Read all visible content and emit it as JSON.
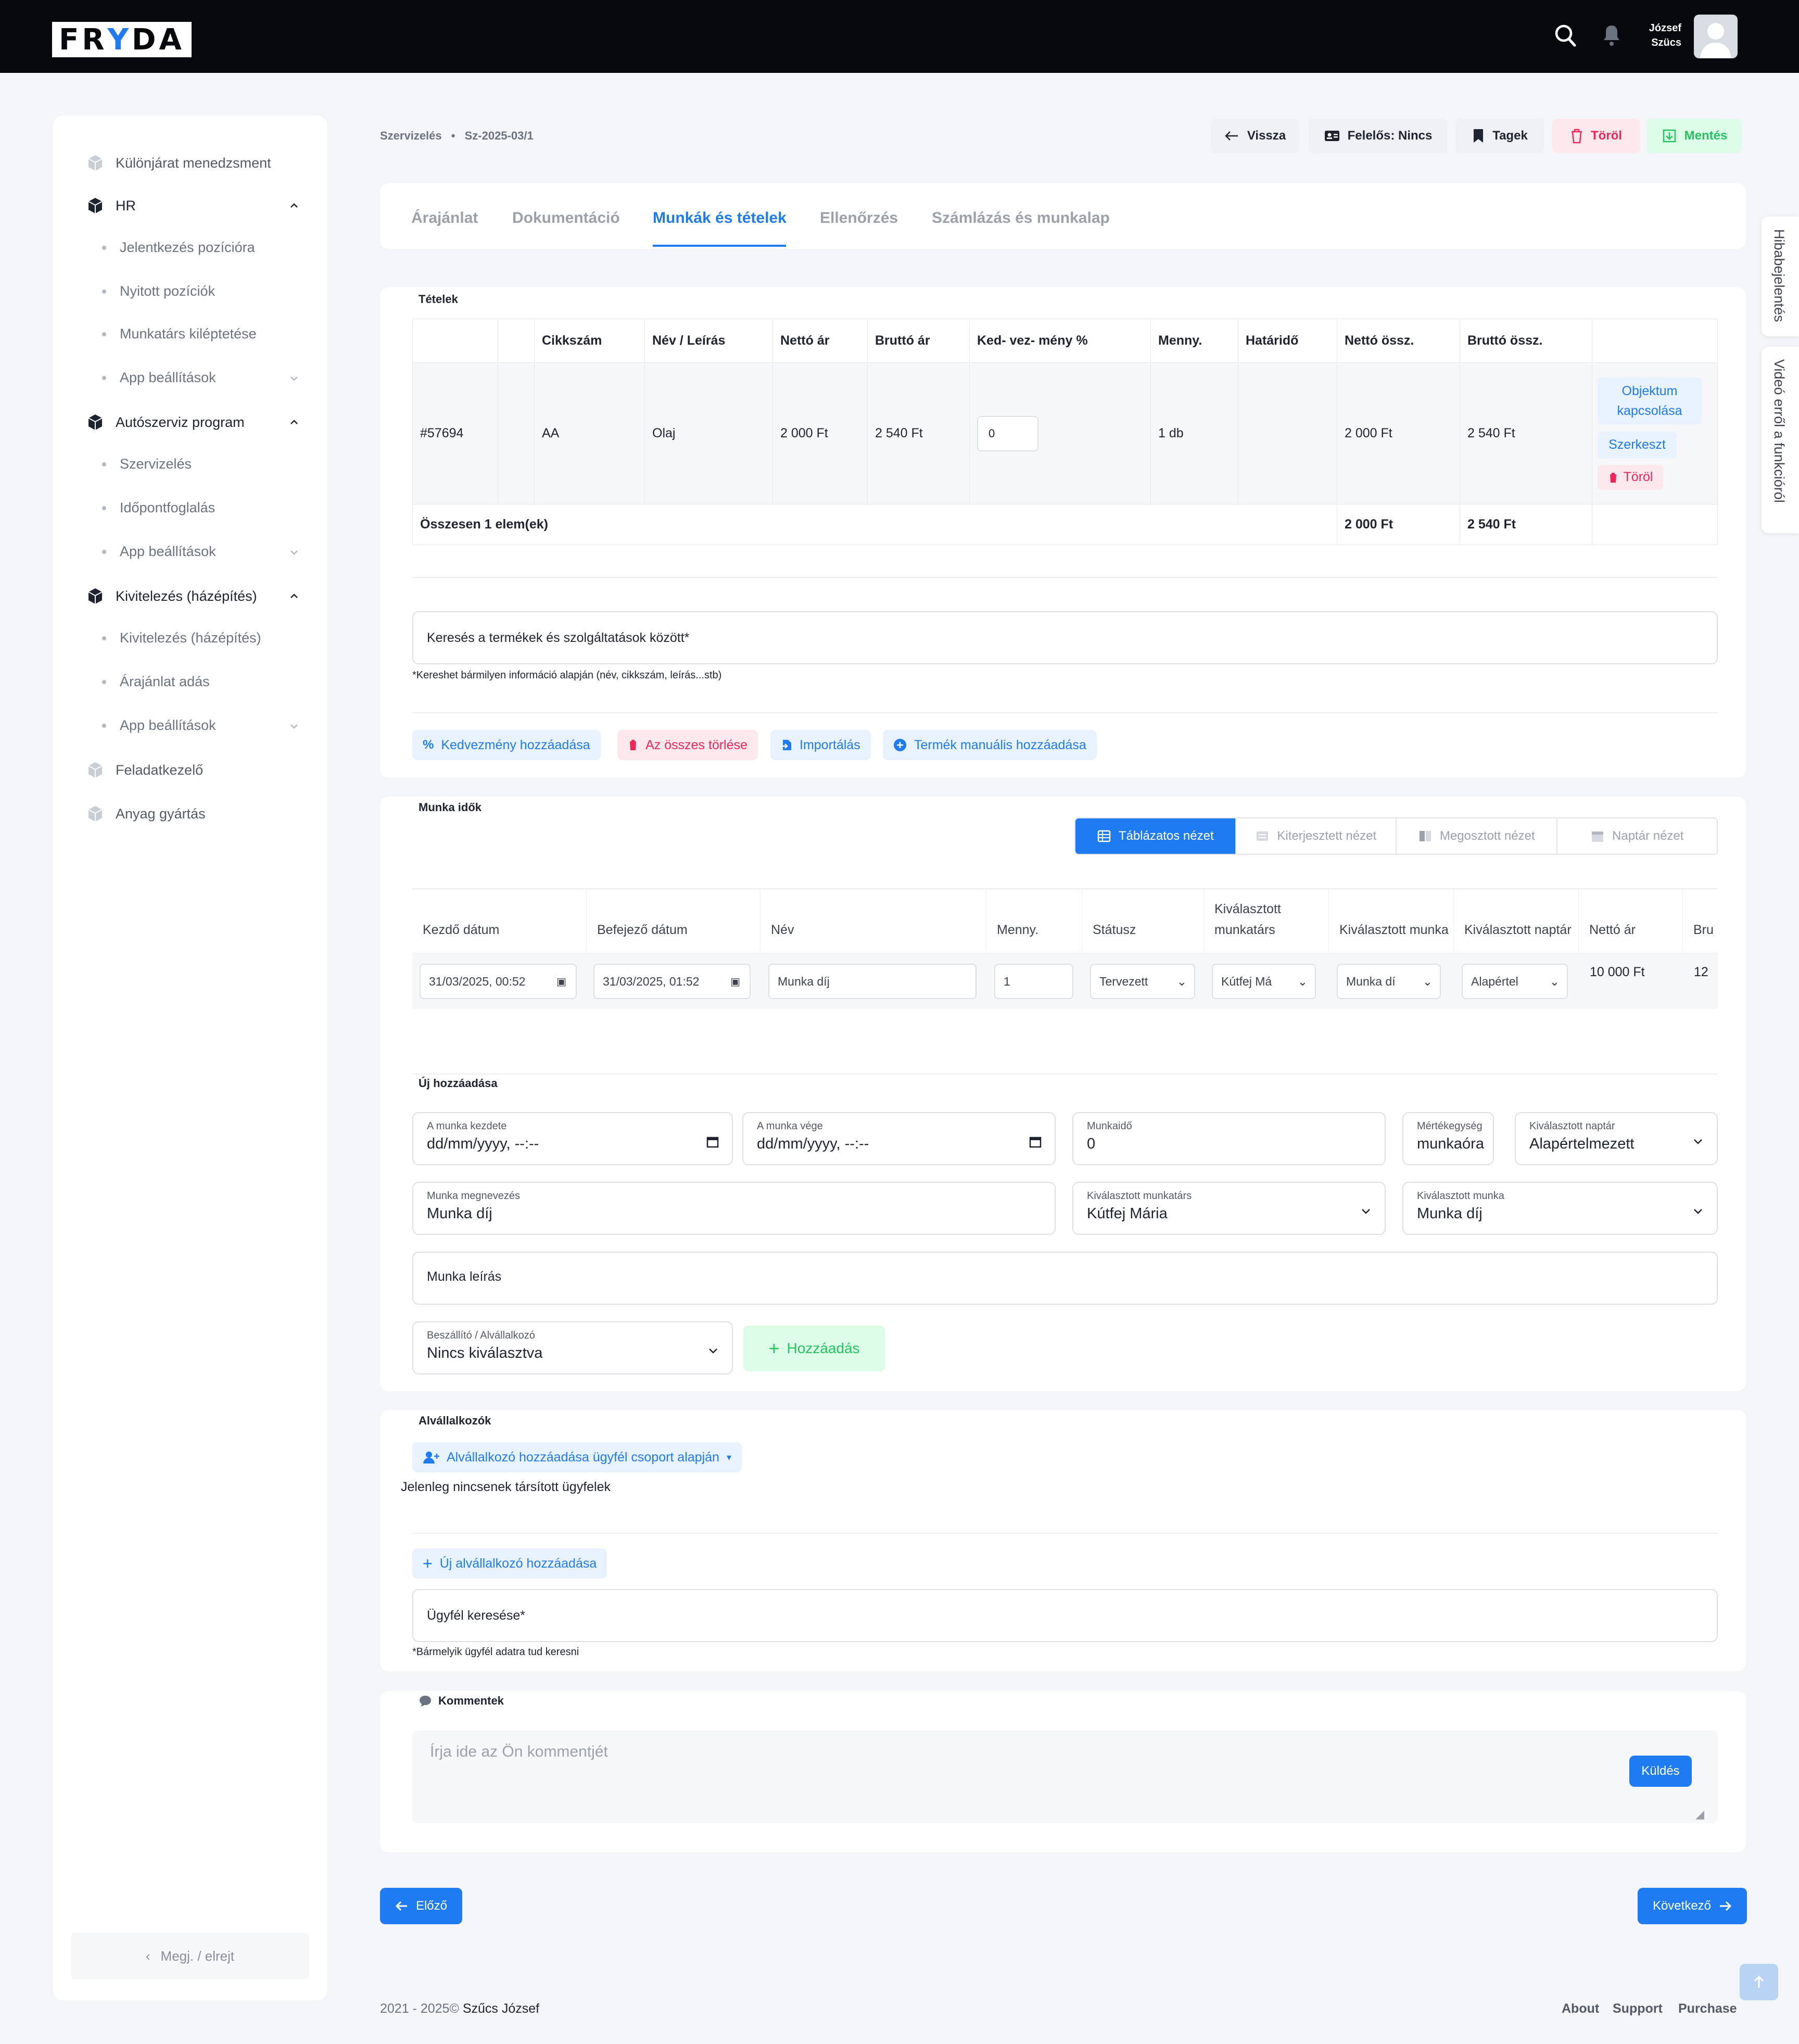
{
  "header": {
    "logo_before": "FR",
    "logo_y": "Y",
    "logo_after": "DA",
    "user_first": "József",
    "user_last": "Szücs"
  },
  "sidebar": {
    "items": [
      {
        "label": "Különjárat menedzsment"
      },
      {
        "label": "HR"
      },
      {
        "label": "Jelentkezés pozícióra"
      },
      {
        "label": "Nyitott pozíciók"
      },
      {
        "label": "Munkatárs kiléptetése"
      },
      {
        "label": "App beállítások"
      },
      {
        "label": "Autószerviz program"
      },
      {
        "label": "Szervizelés"
      },
      {
        "label": "Időpontfoglalás"
      },
      {
        "label": "App beállítások"
      },
      {
        "label": "Kivitelezés (házépítés)"
      },
      {
        "label": "Kivitelezés (házépítés)"
      },
      {
        "label": "Árajánlat adás"
      },
      {
        "label": "App beállítások"
      },
      {
        "label": "Feladatkezelő"
      },
      {
        "label": "Anyag gyártás"
      }
    ],
    "collapse_label": "Megj. / elrejt"
  },
  "breadcrumb": {
    "section": "Szervizelés",
    "separator": "•",
    "id": "Sz-2025-03/1"
  },
  "actions": {
    "back": "Vissza",
    "responsible": "Felelős: Nincs",
    "tags": "Tagek",
    "delete": "Töröl",
    "save": "Mentés"
  },
  "tabs": [
    "Árajánlat",
    "Dokumentáció",
    "Munkák és tételek",
    "Ellenőrzés",
    "Számlázás és munkalap"
  ],
  "items_section": {
    "title": "Tételek",
    "columns": [
      "",
      "",
      "Cikkszám",
      "Név / Leírás",
      "Nettó ár",
      "Bruttó ár",
      "Ked- vez- mény %",
      "Menny.",
      "Határidő",
      "Nettó össz.",
      "Bruttó össz.",
      ""
    ],
    "row": {
      "id": "#57694",
      "sku": "AA",
      "name": "Olaj",
      "net": "2 000 Ft",
      "gross": "2 540 Ft",
      "discount": "0",
      "qty": "1 db",
      "deadline": "",
      "net_total": "2 000 Ft",
      "gross_total": "2 540 Ft"
    },
    "row_actions": {
      "link": "Objektum kapcsolása",
      "edit": "Szerkeszt",
      "delete": "Töröl"
    },
    "total": {
      "label": "Összesen 1 elem(ek)",
      "net": "2 000 Ft",
      "gross": "2 540 Ft"
    },
    "search_placeholder": "Keresés a termékek és szolgáltatások között*",
    "search_hint": "*Kereshet bármilyen információ alapján (név, cikkszám, leírás...stb)",
    "buttons": {
      "discount": "Kedvezmény hozzáadása",
      "clear": "Az összes törlése",
      "import": "Importálás",
      "manual": "Termék manuális hozzáadása"
    }
  },
  "work_section": {
    "title": "Munka idők",
    "views": [
      "Táblázatos nézet",
      "Kiterjesztett nézet",
      "Megosztott nézet",
      "Naptár nézet"
    ],
    "columns": [
      "Kezdő dátum",
      "Befejező dátum",
      "Név",
      "Menny.",
      "Státusz",
      "Kiválasztott munkatárs",
      "Kiválasztott munka",
      "Kiválasztott naptár",
      "Nettó ár",
      "Bru"
    ],
    "row": {
      "start": "31/03/2025, 00:52",
      "end": "31/03/2025, 01:52",
      "name": "Munka díj",
      "qty": "1",
      "status": "Tervezett",
      "worker": "Kútfej Má",
      "work": "Munka dí",
      "calendar": "Alapértel",
      "net": "10 000 Ft",
      "gross_partial": "12"
    },
    "new_title": "Új hozzáadása",
    "fields": {
      "start_label": "A munka kezdete",
      "start_value": "dd/mm/yyyy, --:--",
      "end_label": "A munka vége",
      "end_value": "dd/mm/yyyy, --:--",
      "duration_label": "Munkaidő",
      "duration_value": "0",
      "unit_label": "Mértékegység",
      "unit_value": "munkaóra",
      "calendar_label": "Kiválasztott naptár",
      "calendar_value": "Alapértelmezett",
      "name_label": "Munka megnevezés",
      "name_value": "Munka díj",
      "worker_label": "Kiválasztott munkatárs",
      "worker_value": "Kútfej Mária",
      "work_label": "Kiválasztott munka",
      "work_value": "Munka díj",
      "description": "Munka leírás",
      "supplier_label": "Beszállító / Alvállalkozó",
      "supplier_value": "Nincs kiválasztva"
    },
    "add_button": "Hozzáadás"
  },
  "subcontractors": {
    "title": "Alvállalkozók",
    "group_button": "Alvállalkozó hozzáadása ügyfél csoport alapján",
    "empty_text": "Jelenleg nincsenek társított ügyfelek",
    "new_button": "Új alvállalkozó hozzáadása",
    "search_placeholder": "Ügyfél keresése*",
    "search_hint": "*Bármelyik ügyfél adatra tud keresni"
  },
  "comments": {
    "title": "Kommentek",
    "placeholder": "Írja ide az Ön kommentjét",
    "send": "Küldés"
  },
  "navigation": {
    "prev": "Előző",
    "next": "Következő"
  },
  "side_tabs": {
    "bug": "Hibabejelentés",
    "video": "Videó erről a funkcióról"
  },
  "footer": {
    "years": "2021 - 2025©",
    "author": "Szűcs József",
    "links": [
      "About",
      "Support",
      "Purchase"
    ]
  },
  "colors": {
    "accent": "#1f7bf2",
    "danger": "#f0255a",
    "success": "#22c55e",
    "topbar": "#07090d"
  }
}
